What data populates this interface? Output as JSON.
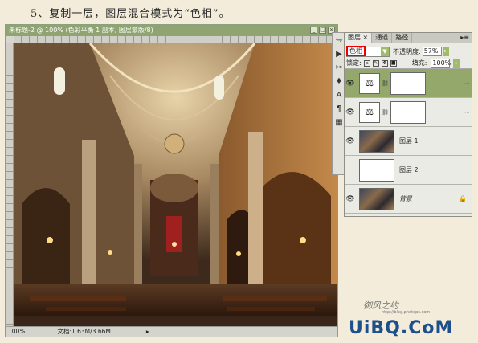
{
  "step_title": "5、复制一层，图层混合模式为“色相”。",
  "document": {
    "title": "未标题-2 @ 100% (色彩平衡 1 副本, 图层蒙版/8)",
    "zoom": "100%",
    "doc_size": "文档:1.63M/3.66M",
    "ctrls": [
      "_",
      "□",
      "×"
    ]
  },
  "tools": [
    "↪",
    "▶",
    "✂",
    "♦",
    "A",
    "¶",
    "▦"
  ],
  "panel": {
    "tabs": [
      "图层",
      "通道",
      "路径"
    ],
    "tab_close": "×",
    "menu": "▸≡",
    "blend_mode": "色相",
    "opacity_label": "不透明度:",
    "opacity_value": "57%",
    "lock_label": "锁定:",
    "fill_label": "填充:",
    "fill_value": "100%",
    "layers": [
      {
        "name": "",
        "type": "adjustment",
        "selected": true
      },
      {
        "name": "",
        "type": "adjustment",
        "selected": false
      },
      {
        "name": "图层 1",
        "type": "photo",
        "selected": false
      },
      {
        "name": "图层 2",
        "type": "blank",
        "selected": false
      },
      {
        "name": "背景",
        "type": "photo",
        "selected": false,
        "locked": true
      }
    ]
  },
  "watermark": "UiBQ.CoM",
  "signature": "御风之约",
  "tiny_url": "http://blog.photops.com"
}
